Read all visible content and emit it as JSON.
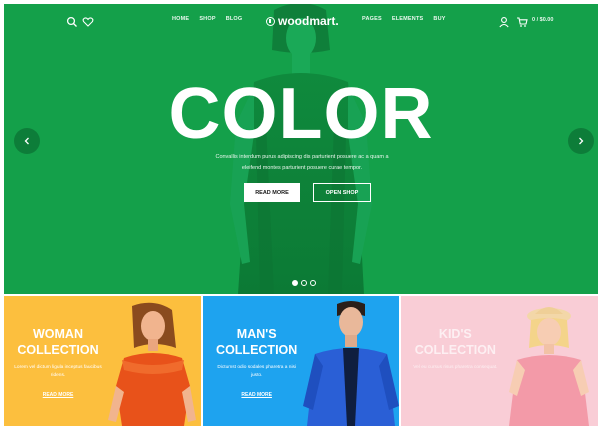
{
  "header": {
    "nav_left": [
      "HOME",
      "SHOP",
      "BLOG"
    ],
    "logo_text": "woodmart.",
    "nav_right": [
      "PAGES",
      "ELEMENTS",
      "BUY"
    ],
    "cart_text": "0 / $0.00",
    "icons": [
      "search-icon",
      "heart-icon",
      "user-icon",
      "cart-icon"
    ]
  },
  "hero": {
    "headline": "COLOR",
    "subtext": "Convallis interdum purus adipiscing dis parturient posuere ac a quam a eleifend montes parturient posuere curae tempor.",
    "read_more": "READ MORE",
    "open_shop": "OPEN SHOP",
    "slides_total": 3,
    "slide_active": 1,
    "colors": {
      "background": "#14a04a"
    }
  },
  "collections": [
    {
      "title_line1": "WOMAN",
      "title_line2": "COLLECTION",
      "desc": "Lorem vel dictum ligula inceptus faucibus ridens.",
      "link": "READ MORE",
      "color": "#fcbf3e"
    },
    {
      "title_line1": "MAN'S",
      "title_line2": "COLLECTION",
      "desc": "Dictumst odio sodales pharetra a nisi justo.",
      "link": "READ MORE",
      "color": "#1ea3ef"
    },
    {
      "title_line1": "KID'S",
      "title_line2": "COLLECTION",
      "desc": "Vel eu cursus risus pharetra consequat.",
      "link": "",
      "color": "#f9cdd6"
    }
  ]
}
